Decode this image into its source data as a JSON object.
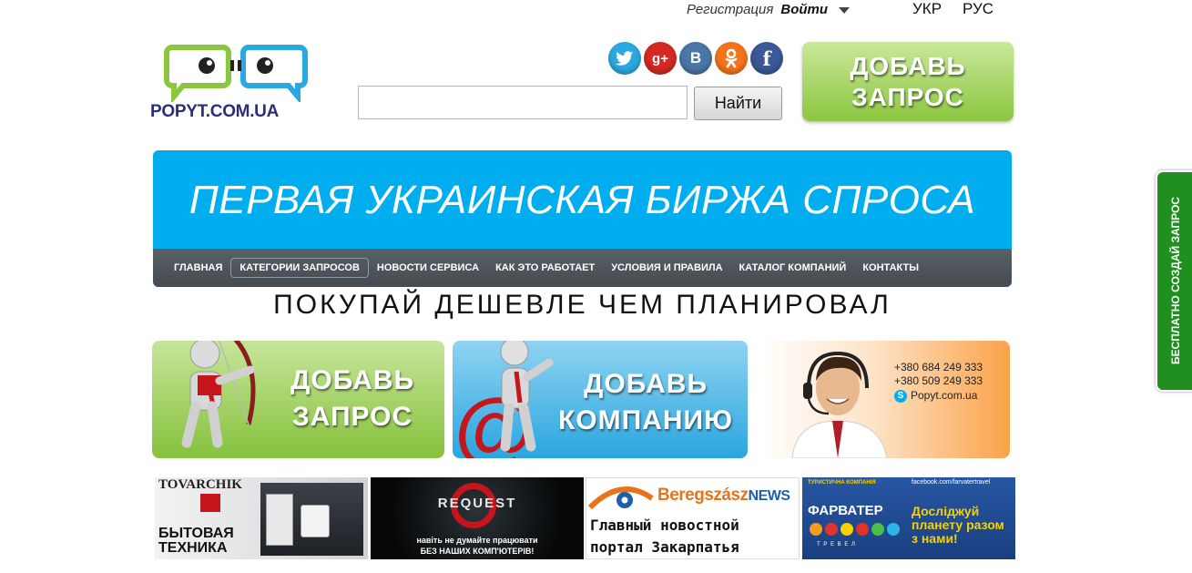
{
  "topbar": {
    "register": "Регистрация",
    "login": "Войти",
    "lang_ukr": "УКР",
    "lang_rus": "РУС"
  },
  "logo": {
    "text": "POPYT.COM.UA"
  },
  "search": {
    "value": "",
    "button": "Найти"
  },
  "social": [
    {
      "name": "twitter",
      "glyph": "t",
      "color": "#2aa9e0"
    },
    {
      "name": "google-plus",
      "glyph": "g+",
      "color": "#d42a22"
    },
    {
      "name": "vkontakte",
      "glyph": "B",
      "color": "#4a76a8"
    },
    {
      "name": "odnoklassniki",
      "glyph": "ok",
      "color": "#f4731c"
    },
    {
      "name": "facebook",
      "glyph": "f",
      "color": "#3b5998"
    }
  ],
  "add_request": {
    "line1": "ДОБАВЬ",
    "line2": "ЗАПРОС"
  },
  "hero": {
    "title": "ПЕРВАЯ УКРАИНСКАЯ БИРЖА СПРОСА"
  },
  "nav": [
    "ГЛАВНАЯ",
    "КАТЕГОРИИ ЗАПРОСОВ",
    "НОВОСТИ СЕРВИСА",
    "КАК ЭТО РАБОТАЕТ",
    "УСЛОВИЯ И ПРАВИЛА",
    "КАТАЛОГ КОМПАНИЙ",
    "КОНТАКТЫ"
  ],
  "slogan": "ПОКУПАЙ ДЕШЕВЛЕ ЧЕМ ПЛАНИРОВАЛ",
  "tiles": {
    "request": {
      "line1": "ДОБАВЬ",
      "line2": "ЗАПРОС"
    },
    "company": {
      "line1": "ДОБАВЬ",
      "line2": "КОМПАНИЮ"
    }
  },
  "contact": {
    "phone1": "+380 684 249 333",
    "phone2": "+380 509 249 333",
    "skype": "Popyt.com.ua"
  },
  "ads": {
    "tovarchik": {
      "brand": "TOVARCHIK",
      "line1": "БЫТОВАЯ",
      "line2": "ТЕХНИКА"
    },
    "request": {
      "brand": "REQUEST",
      "line1": "навіть не думайте працювати",
      "line2": "БЕЗ НАШИХ КОМП'ЮТЕРІВ!"
    },
    "beregszasz": {
      "brand1": "Beregszász",
      "brand2": "NEWS",
      "line1": "Главный новостной",
      "line2": "портал Закарпатья"
    },
    "farvater": {
      "top_left": "ТУРИСТИЧНА КОМПАНІЯ",
      "top_right": "facebook.com/farvatertravel",
      "brand": "ФАРВАТЕР",
      "sub": "Т Р Е В Е Л",
      "line1": "Досліджуй",
      "line2": "планету разом",
      "line3": "з нами!"
    }
  },
  "side_tab": {
    "label": "БЕСПЛАТНО СОЗДАЙ ЗАПРОС"
  }
}
